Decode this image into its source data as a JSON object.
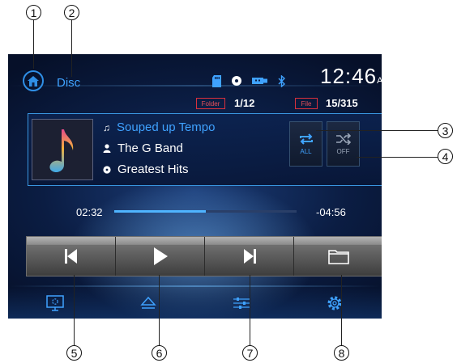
{
  "callouts": [
    "1",
    "2",
    "3",
    "4",
    "5",
    "6",
    "7",
    "8"
  ],
  "header": {
    "source_label": "Disc",
    "clock_time": "12:46",
    "clock_suffix": "A"
  },
  "counters": {
    "folder_label": "Folder",
    "folder_value": "1/12",
    "file_label": "File",
    "file_value": "15/315"
  },
  "track": {
    "title": "Souped up Tempo",
    "artist": "The G Band",
    "album": "Greatest Hits"
  },
  "modes": {
    "repeat_label": "ALL",
    "shuffle_label": "OFF"
  },
  "progress": {
    "elapsed": "02:32",
    "remaining": "-04:56",
    "fraction": 0.5
  },
  "controls": [
    "previous-track",
    "play",
    "next-track",
    "folder"
  ],
  "bottom_bar": [
    "display",
    "eject",
    "equalizer",
    "settings"
  ],
  "colors": {
    "accent": "#3fa2ff",
    "title": "#3fa2ff",
    "label_red": "#e8505a"
  },
  "status_icons": [
    "sd-card-icon",
    "disc-icon",
    "usb-icon",
    "bluetooth-icon"
  ]
}
